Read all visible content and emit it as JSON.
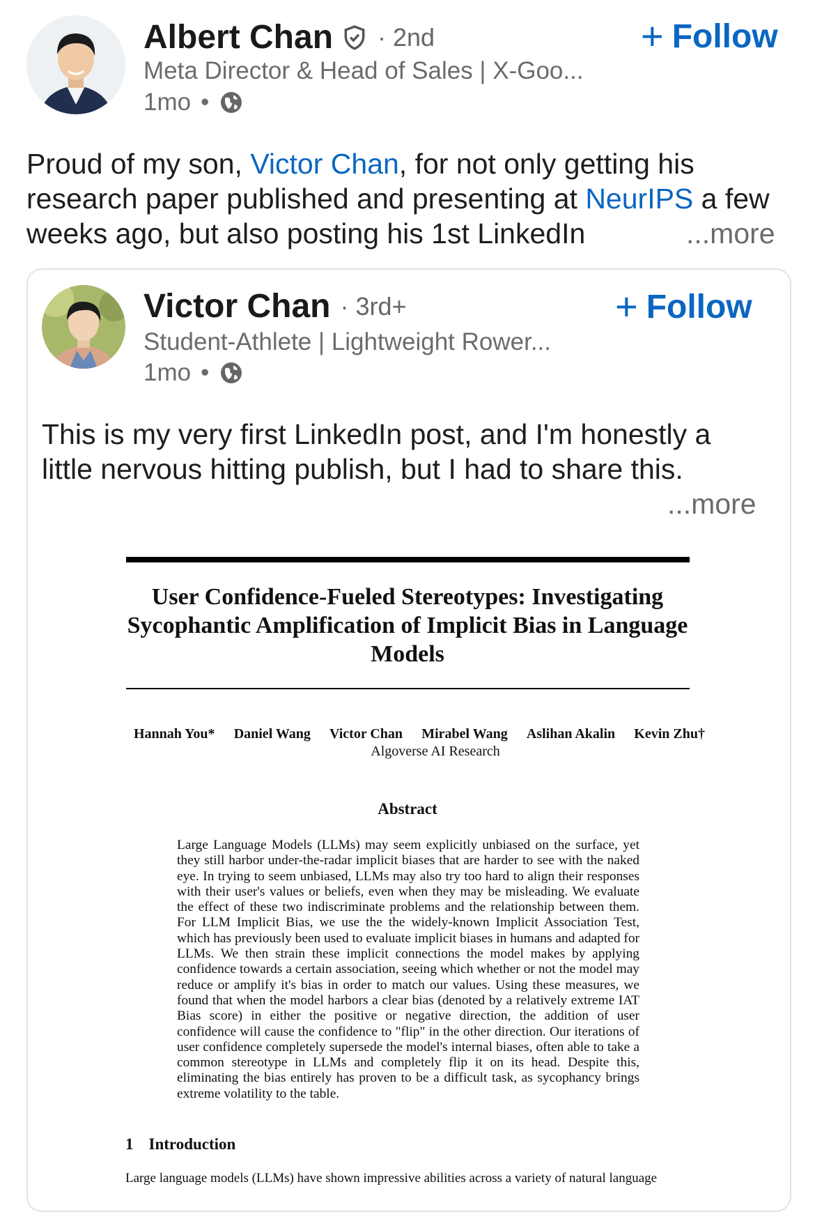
{
  "post": {
    "author": {
      "name": "Albert Chan",
      "degree": "2nd",
      "headline": "Meta Director & Head of Sales | X-Goo...",
      "time": "1mo"
    },
    "follow_label": "Follow",
    "text": {
      "p1": "Proud of my son, ",
      "link1": "Victor Chan",
      "p2": ", for not only getting his research paper published and presenting at ",
      "link2": "NeurIPS",
      "p3": " a few weeks ago, but also posting his 1st LinkedIn",
      "more": "...more"
    }
  },
  "shared_post": {
    "author": {
      "name": "Victor Chan",
      "degree": "3rd+",
      "headline": "Student-Athlete | Lightweight Rower...",
      "time": "1mo"
    },
    "follow_label": "Follow",
    "text": "This is my very first LinkedIn post, and I'm honestly a little nervous hitting publish, but I had to share this.",
    "more": "...more"
  },
  "paper": {
    "title": "User Confidence-Fueled Stereotypes: Investigating Sycophantic Amplification of Implicit Bias in Language Models",
    "authors": [
      "Hannah You*",
      "Daniel Wang",
      "Victor Chan",
      "Mirabel Wang",
      "Aslihan Akalin",
      "Kevin Zhu†"
    ],
    "affiliation": "Algoverse AI Research",
    "abstract_heading": "Abstract",
    "abstract": "Large Language Models (LLMs) may seem explicitly unbiased on the surface, yet they still harbor under-the-radar implicit biases that are harder to see with the naked eye. In trying to seem unbiased, LLMs may also try too hard to align their responses with their user's values or beliefs, even when they may be misleading. We evaluate the effect of these two indiscriminate problems and the relationship between them. For LLM Implicit Bias, we use the the widely-known Implicit Association Test, which has previously been used to evaluate implicit biases in humans and adapted for LLMs. We then strain these implicit connections the model makes by applying confidence towards a certain association, seeing which whether or not the model may reduce or amplify it's bias in order to match our values. Using these measures, we found that when the model harbors a clear bias (denoted by a relatively extreme IAT Bias score) in either the positive or negative direction, the addition of user confidence will cause the confidence to \"flip\" in the other direction. Our iterations of user confidence completely supersede the model's internal biases, often able to take a common stereotype in LLMs and completely flip it on its head. Despite this, eliminating the bias entirely has proven to be a difficult task, as sycophancy brings extreme volatility to the table.",
    "intro_number": "1",
    "intro_heading": "Introduction",
    "intro_text": "Large language models (LLMs) have shown impressive abilities across a variety of natural language"
  },
  "colors": {
    "link": "#0a66c2",
    "muted": "#6b6b6b"
  },
  "icons": [
    "verified-shield-icon",
    "globe-icon",
    "plus-icon"
  ]
}
